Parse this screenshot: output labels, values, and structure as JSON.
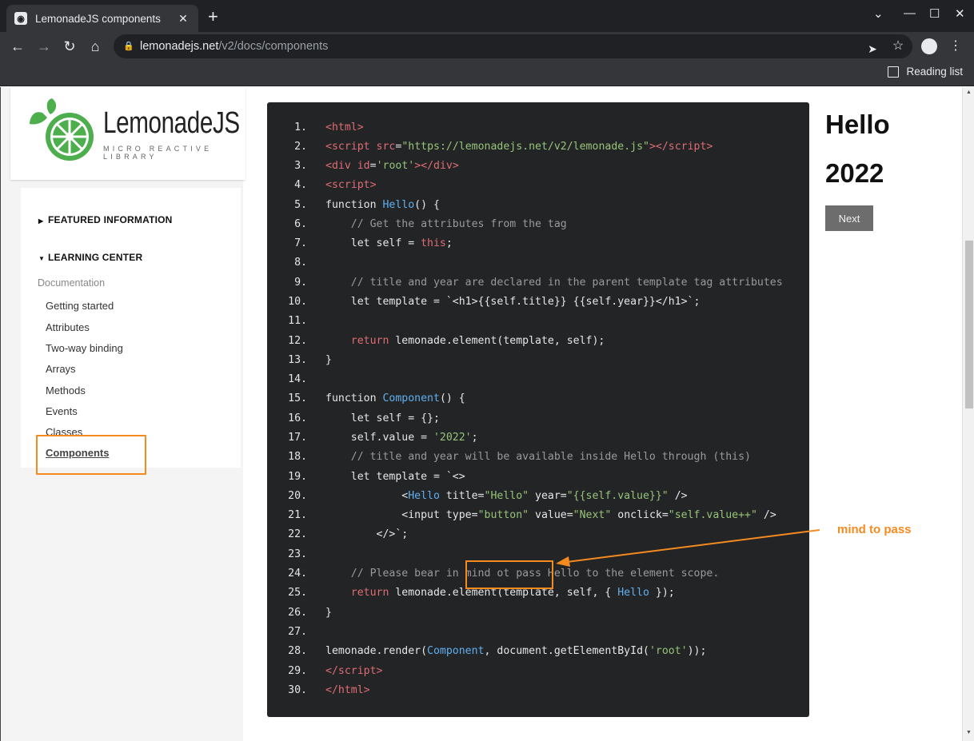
{
  "browser": {
    "tab_title": "LemonadeJS components",
    "url_host": "lemonadejs.net",
    "url_path": "/v2/docs/components",
    "reading_list": "Reading list"
  },
  "logo": {
    "name": "LemonadeJS",
    "tagline": "MICRO REACTIVE LIBRARY"
  },
  "sidebar": {
    "sections": [
      {
        "label": "FEATURED INFORMATION",
        "expanded": false
      },
      {
        "label": "LEARNING CENTER",
        "expanded": true
      }
    ],
    "group_label": "Documentation",
    "items": [
      {
        "label": "Getting started"
      },
      {
        "label": "Attributes"
      },
      {
        "label": "Two-way binding"
      },
      {
        "label": "Arrays"
      },
      {
        "label": "Methods"
      },
      {
        "label": "Events"
      },
      {
        "label": "Classes"
      },
      {
        "label": "Components",
        "active": true
      }
    ]
  },
  "code": {
    "line_numbers": [
      "1.",
      "2.",
      "3.",
      "4.",
      "5.",
      "6.",
      "7.",
      "8.",
      "9.",
      "10.",
      "11.",
      "12.",
      "13.",
      "14.",
      "15.",
      "16.",
      "17.",
      "18.",
      "19.",
      "20.",
      "21.",
      "22.",
      "23.",
      "24.",
      "25.",
      "26.",
      "27.",
      "28.",
      "29.",
      "30."
    ]
  },
  "annotation": {
    "label": "mind to pass"
  },
  "preview": {
    "title": "Hello",
    "year": "2022",
    "button": "Next"
  },
  "colors": {
    "accent_orange": "#f58a1f",
    "code_bg": "#222426",
    "logo_green": "#4cae4c"
  }
}
